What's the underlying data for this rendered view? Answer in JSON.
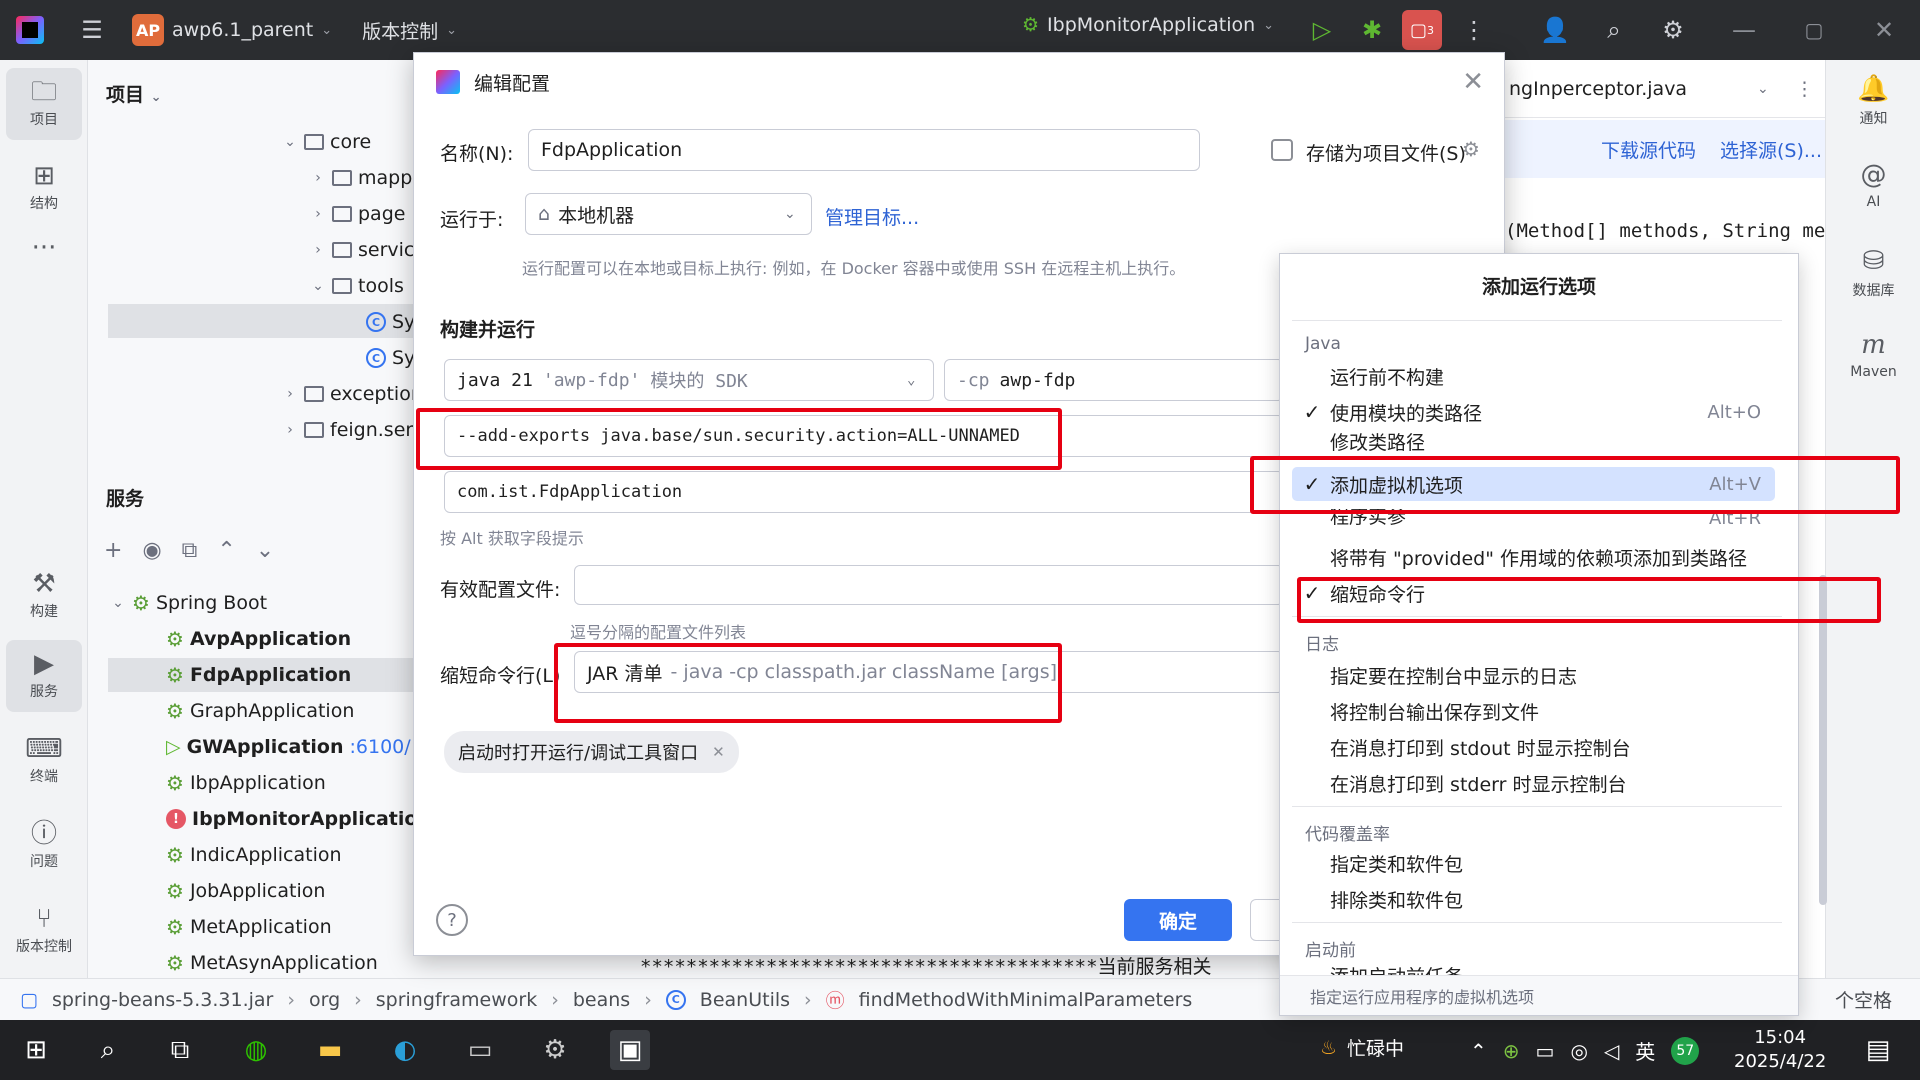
{
  "titlebar": {
    "project_badge": "AP",
    "project_name": "awp6.1_parent",
    "vcs": "版本控制",
    "run_config": "IbpMonitorApplication",
    "notif_count": "3"
  },
  "left_strip": {
    "project": "项目",
    "structure": "结构",
    "build": "构建",
    "services": "服务",
    "terminal": "终端",
    "problems": "问题",
    "vcs": "版本控制"
  },
  "project_panel": {
    "title": "项目",
    "tree": [
      {
        "label": "core"
      },
      {
        "label": "mapp"
      },
      {
        "label": "page"
      },
      {
        "label": "servic"
      },
      {
        "label": "tools"
      },
      {
        "label": "Sy"
      },
      {
        "label": "Sy"
      },
      {
        "label": "exception"
      },
      {
        "label": "feign.ser"
      }
    ]
  },
  "services_panel": {
    "title": "服务",
    "root": "Spring Boot",
    "apps": [
      {
        "name": "AvpApplication",
        "bold": true
      },
      {
        "name": "FdpApplication",
        "bold": true
      },
      {
        "name": "GraphApplication",
        "bold": false
      },
      {
        "name": "GWApplication",
        "bold": true,
        "port": ":6100/"
      },
      {
        "name": "IbpApplication",
        "bold": false
      },
      {
        "name": "IbpMonitorApplication",
        "bold": true
      },
      {
        "name": "IndicApplication",
        "bold": false
      },
      {
        "name": "JobApplication",
        "bold": false
      },
      {
        "name": "MetApplication",
        "bold": false
      },
      {
        "name": "MetAsynApplication",
        "bold": false
      }
    ]
  },
  "editor": {
    "tab": "ngInperceptor.java",
    "download_source": "下载源代码",
    "choose_source": "选择源(S)...",
    "code_line": "(Method[] methods, String me",
    "code_bottom": "****************************************当前服务相关",
    "right_hint": "个空格"
  },
  "right_strip": {
    "notifications": "通知",
    "ai": "AI",
    "database": "数据库",
    "maven": "Maven"
  },
  "dialog": {
    "title": "编辑配置",
    "name_label": "名称(N):",
    "name_value": "FdpApplication",
    "store_label": "存储为项目文件(S)",
    "run_on_label": "运行于:",
    "run_on_value": "本地机器",
    "manage_targets": "管理目标...",
    "run_on_hint": "运行配置可以在本地或目标上执行: 例如，在 Docker 容器中或使用 SSH 在远程主机上执行。",
    "build_run": "构建并运行",
    "sdk_prefix": "java 21",
    "sdk_module": "'awp-fdp'",
    "sdk_suffix": "模块的 SDK",
    "cp_flag": "-cp",
    "cp_value": "awp-fdp",
    "vm_options": "--add-exports java.base/sun.security.action=ALL-UNNAMED",
    "main_class": "com.ist.FdpApplication",
    "alt_hint": "按 Alt 获取字段提示",
    "profiles_label": "有效配置文件:",
    "profiles_hint": "逗号分隔的配置文件列表",
    "shorten_label": "缩短命令行(L)",
    "shorten_value": "JAR 清单",
    "shorten_hint": "- java -cp classpath.jar className [args]",
    "chip": "启动时打开运行/调试工具窗口",
    "ok": "确定"
  },
  "popup": {
    "title": "添加运行选项",
    "sections": {
      "java": "Java",
      "log": "日志",
      "coverage": "代码覆盖率",
      "before": "启动前"
    },
    "items": [
      {
        "label": "运行前不构建",
        "checked": false,
        "shortcut": ""
      },
      {
        "label": "使用模块的类路径",
        "checked": true,
        "shortcut": "Alt+O"
      },
      {
        "label": "修改类路径",
        "checked": false,
        "shortcut": ""
      },
      {
        "label": "添加虚拟机选项",
        "checked": true,
        "shortcut": "Alt+V"
      },
      {
        "label": "程序实参",
        "checked": false,
        "shortcut": "Alt+R"
      },
      {
        "label": "将带有 \"provided\" 作用域的依赖项添加到类路径",
        "checked": false,
        "shortcut": ""
      },
      {
        "label": "缩短命令行",
        "checked": true,
        "shortcut": ""
      },
      {
        "label": "指定要在控制台中显示的日志",
        "checked": false,
        "shortcut": ""
      },
      {
        "label": "将控制台输出保存到文件",
        "checked": false,
        "shortcut": ""
      },
      {
        "label": "在消息打印到 stdout 时显示控制台",
        "checked": false,
        "shortcut": ""
      },
      {
        "label": "在消息打印到 stderr 时显示控制台",
        "checked": false,
        "shortcut": ""
      },
      {
        "label": "指定类和软件包",
        "checked": false,
        "shortcut": ""
      },
      {
        "label": "排除类和软件包",
        "checked": false,
        "shortcut": ""
      },
      {
        "label": "添加启动前任务",
        "checked": false,
        "shortcut": ""
      }
    ],
    "check_mark": "✓",
    "footer": "指定运行应用程序的虚拟机选项"
  },
  "breadcrumb": {
    "jar": "spring-beans-5.3.31.jar",
    "org": "org",
    "sf": "springframework",
    "beans": "beans",
    "cls": "BeanUtils",
    "method": "findMethodWithMinimalParameters"
  },
  "taskbar": {
    "busy": "忙碌中",
    "lang": "英",
    "badge": "57",
    "time": "15:04",
    "date": "2025/4/22"
  }
}
